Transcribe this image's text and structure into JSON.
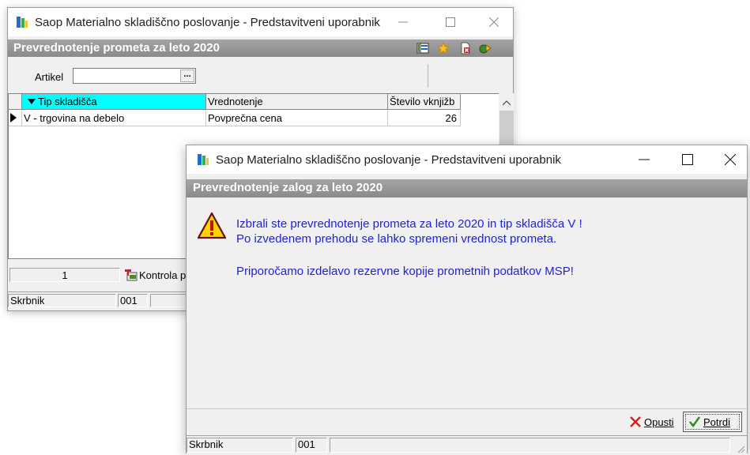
{
  "window1": {
    "title": "Saop Materialno skladiščno poslovanje - Predstavitveni uporabnik",
    "header": "Prevrednotenje prometa za leto 2020",
    "artikel_label": "Artikel",
    "artikel_value": "",
    "lookup_button": "...",
    "columns": [
      "Tip skladišča",
      "Vrednotenje",
      "Število vknjižb"
    ],
    "rows": [
      {
        "tip": "V - trgovina na debelo",
        "vrednotenje": "Povprečna cena",
        "stevilo": "26"
      }
    ],
    "record_count": "1",
    "kontrola_label": "Kontrola p",
    "status": {
      "user": "Skrbnik",
      "code": "001"
    }
  },
  "window2": {
    "title": "Saop Materialno skladiščno poslovanje - Predstavitveni uporabnik",
    "header": "Prevrednotenje zalog za leto 2020",
    "message_line1": "Izbrali ste prevrednotenje prometa za leto 2020 in tip skladišča V !",
    "message_line2": "Po izvedenem prehodu se lahko spremeni vrednost prometa.",
    "message_line3": "Priporočamo izdelavo rezervne kopije prometnih podatkov MSP!",
    "cancel_label": "Opusti",
    "confirm_label": "Potrdi",
    "status": {
      "user": "Skrbnik",
      "code": "001"
    }
  },
  "colors": {
    "message_text": "#1f1fd6",
    "sort_header_bg": "#00ffff",
    "header_gray": "#999999"
  },
  "icons": [
    "app-icon",
    "minimize-icon",
    "maximize-icon",
    "close-icon",
    "columns-icon",
    "star-icon",
    "delete-icon",
    "export-icon",
    "warning-icon",
    "sort-arrow-icon",
    "row-pointer-icon",
    "kontrola-icon",
    "cancel-x-icon",
    "checkmark-icon",
    "resize-grip-icon"
  ]
}
